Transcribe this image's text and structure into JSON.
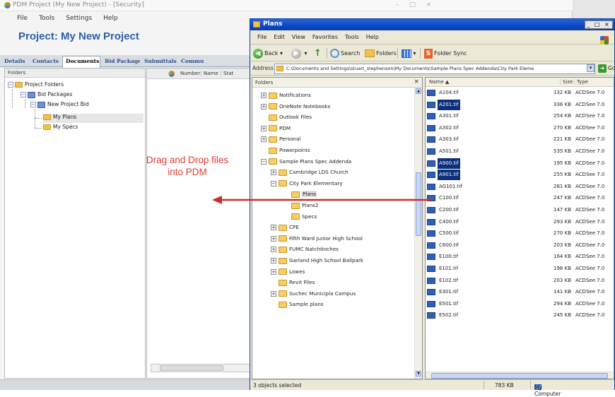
{
  "pdm": {
    "window_title": "PDM Project (My New Project) - [Security]",
    "window_controls": "– □ ×",
    "menu": [
      "File",
      "Tools",
      "Settings",
      "Help"
    ],
    "project_title": "Project: My New Project",
    "tabs": [
      "Details",
      "Contacts",
      "Documents",
      "Bid Packages",
      "Submittals",
      "Commu"
    ],
    "active_tab": "Documents",
    "folders_header": "Folders",
    "tree": {
      "root": "Project Folders",
      "bid_packages": "Bid Packages",
      "new_project_bid": "New Project Bid",
      "my_plans": "My Plans",
      "my_specs": "My Specs"
    },
    "columns": [
      "Number",
      "Name",
      "Stat"
    ],
    "drag_hint": "Drag and Drop files into PDM"
  },
  "explorer": {
    "window_title": "Plans",
    "window_controls": "_ □ ×",
    "menu": [
      "File",
      "Edit",
      "View",
      "Favorites",
      "Tools",
      "Help"
    ],
    "toolbar": {
      "back": "Back",
      "search": "Search",
      "folders": "Folders",
      "folder_sync": "Folder Sync"
    },
    "address_label": "Address",
    "address_value": "C:\\Documents and Settings\\stuart_stephenson\\My Documents\\Sample Plans Spec Addenda\\City Park Eleme",
    "go_label": "Go",
    "tree_header": "Folders",
    "tree_close": "×",
    "tree": [
      {
        "label": "Notifications",
        "pm": "+",
        "indent": 1
      },
      {
        "label": "OneNote Notebooks",
        "pm": "+",
        "indent": 1
      },
      {
        "label": "Outlook Files",
        "pm": "",
        "indent": 1
      },
      {
        "label": "PDM",
        "pm": "+",
        "indent": 1
      },
      {
        "label": "Personal",
        "pm": "+",
        "indent": 1
      },
      {
        "label": "Powerpoints",
        "pm": "",
        "indent": 1
      },
      {
        "label": "Sample Plans Spec Addenda",
        "pm": "−",
        "indent": 1
      },
      {
        "label": "Cambridge LDS Church",
        "pm": "+",
        "indent": 2
      },
      {
        "label": "City Park Elementary",
        "pm": "−",
        "indent": 2
      },
      {
        "label": "Plans",
        "pm": "",
        "indent": 3,
        "selected": true
      },
      {
        "label": "Plans2",
        "pm": "",
        "indent": 3
      },
      {
        "label": "Specs",
        "pm": "",
        "indent": 3
      },
      {
        "label": "CPE",
        "pm": "+",
        "indent": 2
      },
      {
        "label": "Fifth Ward Junior High School",
        "pm": "+",
        "indent": 2
      },
      {
        "label": "FUMC Natchitoches",
        "pm": "+",
        "indent": 2
      },
      {
        "label": "Garland High School Ballpark",
        "pm": "+",
        "indent": 2
      },
      {
        "label": "Lowes",
        "pm": "+",
        "indent": 2
      },
      {
        "label": "Revit Files",
        "pm": "",
        "indent": 2
      },
      {
        "label": "Suchec Municipla Campus",
        "pm": "+",
        "indent": 2
      },
      {
        "label": "Sample plans",
        "pm": "",
        "indent": 2
      }
    ],
    "file_columns": {
      "name": "Name ▲",
      "size": "Size",
      "type": "Type"
    },
    "files": [
      {
        "name": "A104.tif",
        "size": "132 KB",
        "type": "ACDSee 7.0",
        "selected": false
      },
      {
        "name": "A201.tif",
        "size": "336 KB",
        "type": "ACDSee 7.0",
        "selected": true
      },
      {
        "name": "A301.tif",
        "size": "254 KB",
        "type": "ACDSee 7.0",
        "selected": false
      },
      {
        "name": "A302.tif",
        "size": "270 KB",
        "type": "ACDSee 7.0",
        "selected": false
      },
      {
        "name": "A303.tif",
        "size": "221 KB",
        "type": "ACDSee 7.0",
        "selected": false
      },
      {
        "name": "A501.tif",
        "size": "535 KB",
        "type": "ACDSee 7.0",
        "selected": false
      },
      {
        "name": "A900.tif",
        "size": "195 KB",
        "type": "ACDSee 7.0",
        "selected": true
      },
      {
        "name": "A901.tif",
        "size": "255 KB",
        "type": "ACDSee 7.0",
        "selected": true
      },
      {
        "name": "AG101.tif",
        "size": "281 KB",
        "type": "ACDSee 7.0",
        "selected": false
      },
      {
        "name": "C100.tif",
        "size": "247 KB",
        "type": "ACDSee 7.0",
        "selected": false
      },
      {
        "name": "C200.tif",
        "size": "147 KB",
        "type": "ACDSee 7.0",
        "selected": false
      },
      {
        "name": "C400.tif",
        "size": "293 KB",
        "type": "ACDSee 7.0",
        "selected": false
      },
      {
        "name": "C500.tif",
        "size": "270 KB",
        "type": "ACDSee 7.0",
        "selected": false
      },
      {
        "name": "C600.tif",
        "size": "203 KB",
        "type": "ACDSee 7.0",
        "selected": false
      },
      {
        "name": "E100.tif",
        "size": "164 KB",
        "type": "ACDSee 7.0",
        "selected": false
      },
      {
        "name": "E101.tif",
        "size": "196 KB",
        "type": "ACDSee 7.0",
        "selected": false
      },
      {
        "name": "E102.tif",
        "size": "203 KB",
        "type": "ACDSee 7.0",
        "selected": false
      },
      {
        "name": "E301.tif",
        "size": "141 KB",
        "type": "ACDSee 7.0",
        "selected": false
      },
      {
        "name": "E501.tif",
        "size": "294 KB",
        "type": "ACDSee 7.0",
        "selected": false
      },
      {
        "name": "E502.tif",
        "size": "245 KB",
        "type": "ACDSee 7.0",
        "selected": false
      }
    ],
    "status": {
      "selected": "3 objects selected",
      "size": "783 KB",
      "location": "My Computer"
    }
  },
  "colors": {
    "arrow": "#c8302a",
    "drag_text": "#e03a32",
    "project_title": "#2b5fa8",
    "xp_title": "#0b49c5",
    "selection": "#0c2f7a"
  }
}
